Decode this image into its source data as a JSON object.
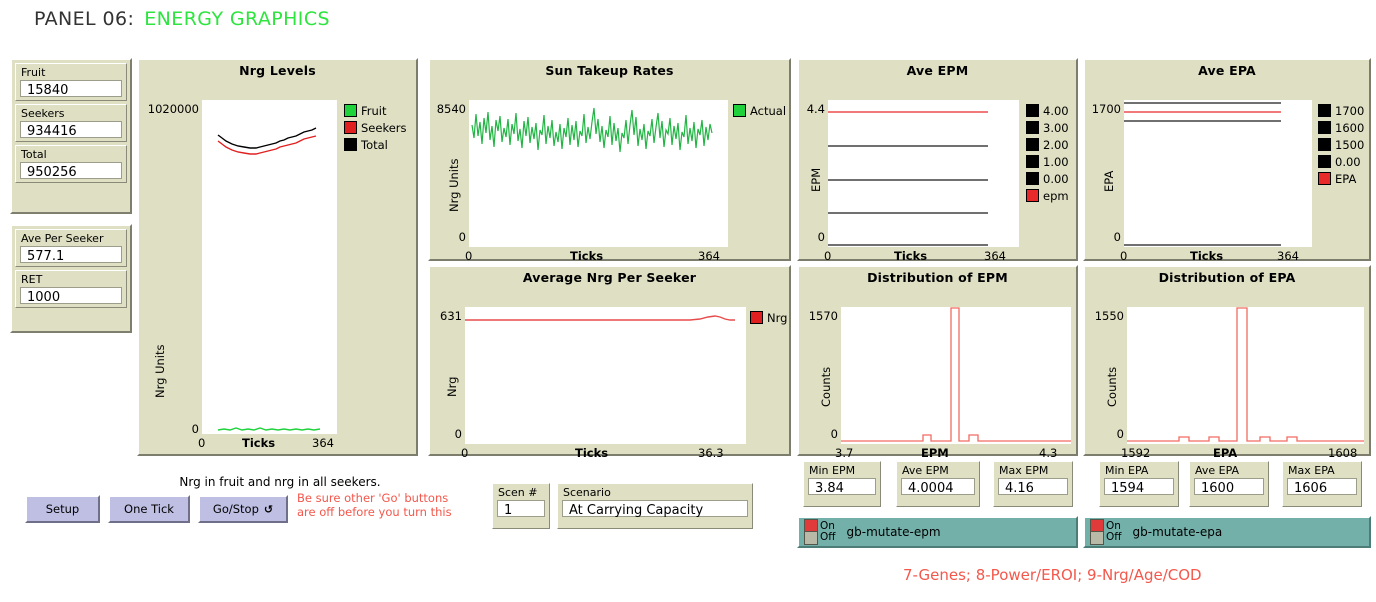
{
  "header": {
    "title": "PANEL 06:",
    "subtitle": "ENERGY GRAPHICS",
    "accent_color": "#2de53e"
  },
  "monitors": {
    "group1": [
      {
        "label": "Fruit",
        "value": "15840"
      },
      {
        "label": "Seekers",
        "value": "934416"
      },
      {
        "label": "Total",
        "value": "950256"
      }
    ],
    "group2": [
      {
        "label": "Ave Per Seeker",
        "value": "577.1"
      },
      {
        "label": "RET",
        "value": "1000"
      }
    ],
    "epm": [
      {
        "label": "Min EPM",
        "value": "3.84"
      },
      {
        "label": "Ave EPM",
        "value": "4.0004"
      },
      {
        "label": "Max EPM",
        "value": "4.16"
      }
    ],
    "epa": [
      {
        "label": "Min EPA",
        "value": "1594"
      },
      {
        "label": "Ave EPA",
        "value": "1600"
      },
      {
        "label": "Max EPA",
        "value": "1606"
      }
    ]
  },
  "buttons": [
    {
      "label": "Setup",
      "forever": ""
    },
    {
      "label": "One Tick",
      "forever": ""
    },
    {
      "label": "Go/Stop",
      "forever": "↺"
    }
  ],
  "notes": {
    "plot_caption": "Nrg in fruit and  nrg in all seekers.",
    "go_warning_line1": "Be sure other 'Go' buttons",
    "go_warning_line2": "are off before you turn this",
    "footer": "7-Genes; 8-Power/EROI; 9-Nrg/Age/COD"
  },
  "scenario": {
    "num_label": "Scen #",
    "num_value": "1",
    "label": "Scenario",
    "value": "At Carrying Capacity"
  },
  "switches": [
    {
      "name": "gb-mutate-epm",
      "on_label": "On",
      "off_label": "Off",
      "state": "On"
    },
    {
      "name": "gb-mutate-epa",
      "on_label": "On",
      "off_label": "Off",
      "state": "On"
    }
  ],
  "chart_data": [
    {
      "id": "nrg_levels",
      "type": "line",
      "title": "Nrg Levels",
      "xlabel": "Ticks",
      "ylabel": "Nrg Units",
      "ylim": [
        0,
        1020000
      ],
      "xlim": [
        0,
        364
      ],
      "ymax_tick": "1020000",
      "ymin_tick": "0",
      "xmin_tick": "0",
      "xmax_tick": "364",
      "legend_position": "right",
      "series": [
        {
          "name": "Fruit",
          "color": "#1fd23c",
          "approx_value": 15840
        },
        {
          "name": "Seekers",
          "color": "#e02020",
          "approx_value": 934416
        },
        {
          "name": "Total",
          "color": "#000000",
          "approx_value": 950256
        }
      ]
    },
    {
      "id": "sun_takeup",
      "type": "line",
      "title": "Sun Takeup Rates",
      "xlabel": "Ticks",
      "ylabel": "Nrg Units",
      "ylim": [
        0,
        8540
      ],
      "xlim": [
        0,
        364
      ],
      "ymax_tick": "8540",
      "ymin_tick": "0",
      "xmin_tick": "0",
      "xmax_tick": "364",
      "legend_position": "right",
      "series": [
        {
          "name": "Actual",
          "color": "#22b544",
          "approx_mean": 7600
        }
      ]
    },
    {
      "id": "ave_epm",
      "type": "line",
      "title": "Ave EPM",
      "xlabel": "Ticks",
      "ylabel": "EPM",
      "ylim": [
        0,
        4.4
      ],
      "xlim": [
        0,
        364
      ],
      "ymax_tick": "4.4",
      "ymin_tick": "0",
      "xmin_tick": "0",
      "xmax_tick": "364",
      "legend_position": "right",
      "series": [
        {
          "name": "4.00",
          "color": "#000000",
          "level": 4.0
        },
        {
          "name": "3.00",
          "color": "#000000",
          "level": 3.0
        },
        {
          "name": "2.00",
          "color": "#000000",
          "level": 2.0
        },
        {
          "name": "1.00",
          "color": "#000000",
          "level": 1.0
        },
        {
          "name": "0.00",
          "color": "#000000",
          "level": 0.0
        },
        {
          "name": "epm",
          "color": "#e82a2a",
          "level": 4.0004
        }
      ]
    },
    {
      "id": "ave_epa",
      "type": "line",
      "title": "Ave EPA",
      "xlabel": "Ticks",
      "ylabel": "EPA",
      "ylim": [
        0,
        1700
      ],
      "xlim": [
        0,
        364
      ],
      "ymax_tick": "1700",
      "ymin_tick": "0",
      "xmin_tick": "0",
      "xmax_tick": "364",
      "legend_position": "right",
      "series": [
        {
          "name": "1700",
          "color": "#000000",
          "level": 1700
        },
        {
          "name": "1600",
          "color": "#000000",
          "level": 1600
        },
        {
          "name": "1500",
          "color": "#000000",
          "level": 1500
        },
        {
          "name": "0.00",
          "color": "#000000",
          "level": 0
        },
        {
          "name": "EPA",
          "color": "#e82a2a",
          "level": 1650
        }
      ]
    },
    {
      "id": "avg_nrg_per_seeker",
      "type": "line",
      "title": "Average Nrg Per Seeker",
      "xlabel": "Ticks",
      "ylabel": "Nrg",
      "ylim": [
        0,
        631
      ],
      "xlim": [
        0,
        36.3
      ],
      "ymax_tick": "631",
      "ymin_tick": "0",
      "xmin_tick": "0",
      "xmax_tick": "36.3",
      "legend_position": "right",
      "series": [
        {
          "name": "Nrg",
          "color": "#e84b4b",
          "level": 628
        }
      ]
    },
    {
      "id": "dist_epm",
      "type": "bar",
      "title": "Distribution of EPM",
      "xlabel": "EPM",
      "ylabel": "Counts",
      "ylim": [
        0,
        1570
      ],
      "xlim": [
        3.7,
        4.3
      ],
      "ymax_tick": "1570",
      "ymin_tick": "0",
      "xmin_tick": "3.7",
      "xmax_tick": "4.3",
      "color": "#f26a60",
      "categories": [
        3.9,
        3.94,
        3.98,
        4.0,
        4.02,
        4.06,
        4.1
      ],
      "values": [
        4,
        40,
        10,
        1570,
        45,
        6,
        3
      ]
    },
    {
      "id": "dist_epa",
      "type": "bar",
      "title": "Distribution of EPA",
      "xlabel": "EPA",
      "ylabel": "Counts",
      "ylim": [
        0,
        1550
      ],
      "xlim": [
        1592,
        1608
      ],
      "ymax_tick": "1550",
      "ymin_tick": "0",
      "xmin_tick": "1592",
      "xmax_tick": "1608",
      "color": "#f26a60",
      "categories": [
        1596,
        1598,
        1600,
        1602,
        1604
      ],
      "values": [
        22,
        20,
        1550,
        24,
        22
      ]
    }
  ]
}
